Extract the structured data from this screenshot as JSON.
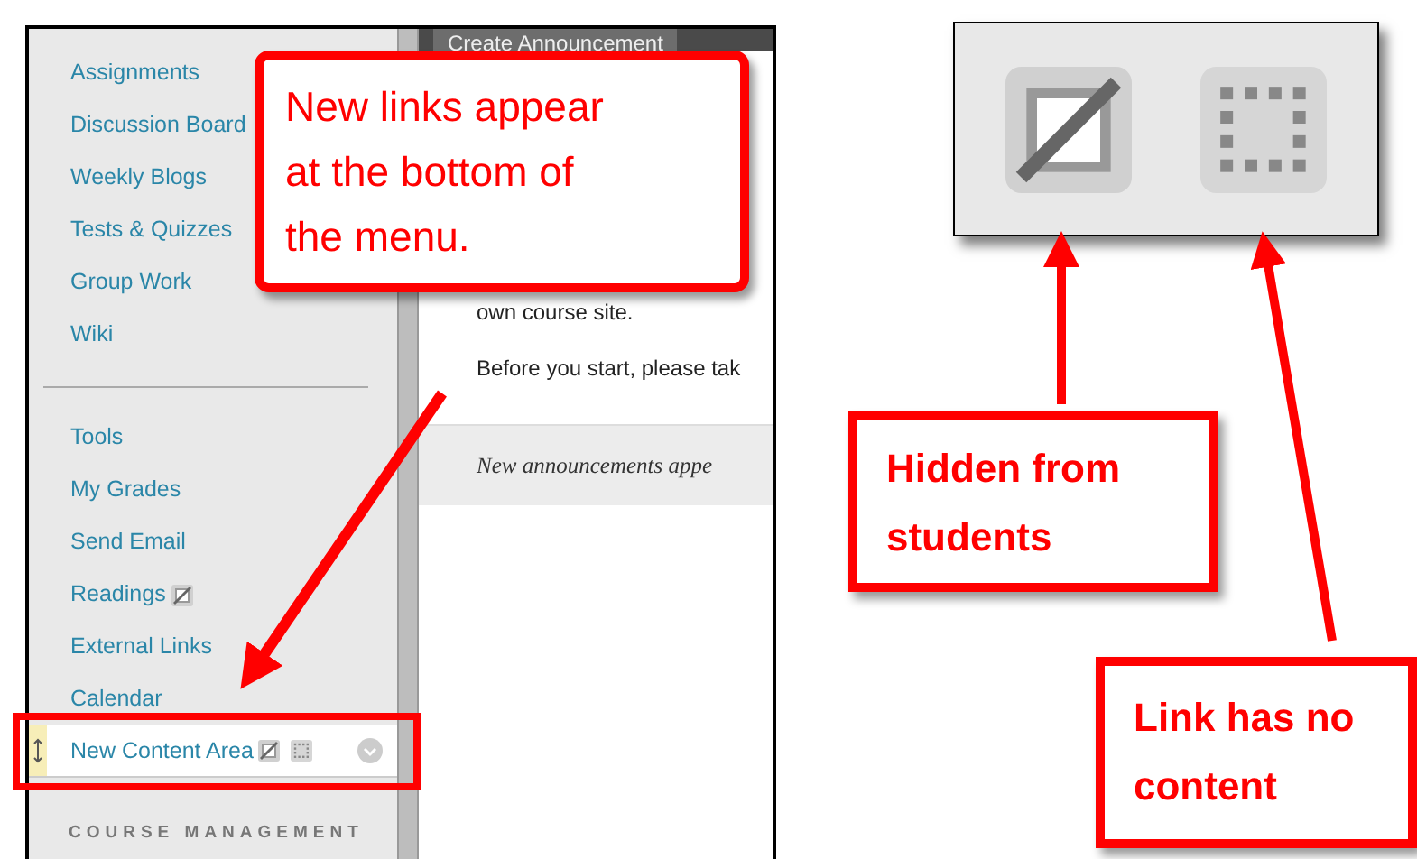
{
  "sidebar": {
    "sections": [
      {
        "items": [
          {
            "label": "Assignments",
            "hidden": false,
            "empty": false,
            "highlighted": false
          },
          {
            "label": "Discussion Board",
            "hidden": false,
            "empty": false,
            "highlighted": false
          },
          {
            "label": "Weekly Blogs",
            "hidden": false,
            "empty": false,
            "highlighted": false
          },
          {
            "label": "Tests & Quizzes",
            "hidden": false,
            "empty": false,
            "highlighted": false
          },
          {
            "label": "Group Work",
            "hidden": false,
            "empty": false,
            "highlighted": false
          },
          {
            "label": "Wiki",
            "hidden": false,
            "empty": false,
            "highlighted": false
          }
        ]
      },
      {
        "items": [
          {
            "label": "Tools",
            "hidden": false,
            "empty": false,
            "highlighted": false
          },
          {
            "label": "My Grades",
            "hidden": false,
            "empty": false,
            "highlighted": false
          },
          {
            "label": "Send Email",
            "hidden": false,
            "empty": false,
            "highlighted": false
          },
          {
            "label": "Readings",
            "hidden": true,
            "empty": false,
            "highlighted": false
          },
          {
            "label": "External Links",
            "hidden": false,
            "empty": false,
            "highlighted": false
          },
          {
            "label": "Calendar",
            "hidden": false,
            "empty": false,
            "highlighted": false
          },
          {
            "label": "New Content Area",
            "hidden": true,
            "empty": true,
            "highlighted": true
          }
        ]
      }
    ],
    "footer_heading": "COURSE MANAGEMENT"
  },
  "content": {
    "button": "Create Announcement",
    "paragraphs": [
      "own course site.",
      "Before you start, please tak"
    ],
    "notice": "New announcements appe"
  },
  "callouts": [
    "New links appear at the bottom of the menu.",
    "Hidden from students",
    "Link has no content"
  ]
}
